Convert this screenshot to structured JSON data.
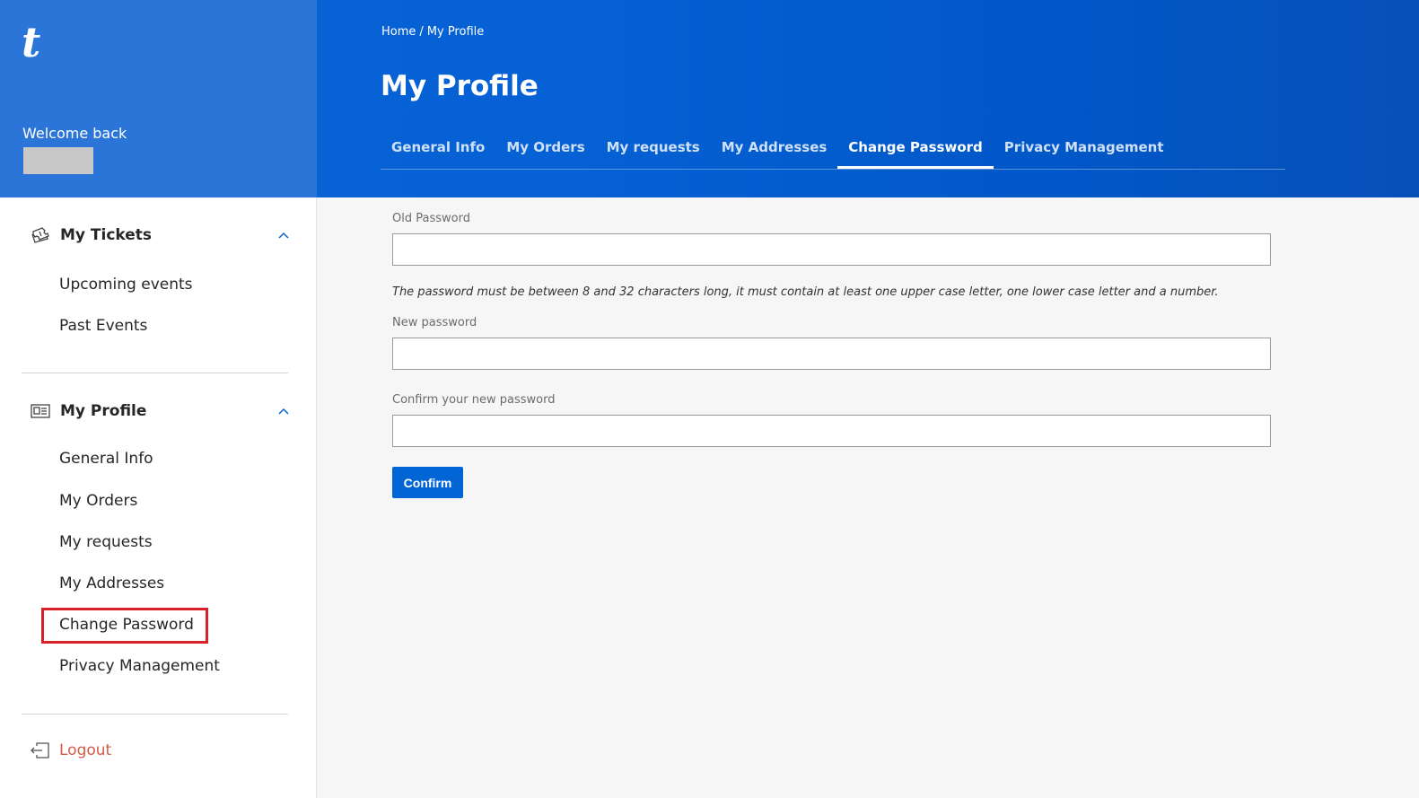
{
  "brand": {
    "logo_text": "t"
  },
  "header": {
    "welcome": "Welcome back",
    "breadcrumb": [
      "Home",
      "/",
      "My Profile"
    ],
    "title": "My Profile",
    "tabs": [
      {
        "label": "General Info",
        "active": false
      },
      {
        "label": "My Orders",
        "active": false
      },
      {
        "label": "My requests",
        "active": false
      },
      {
        "label": "My Addresses",
        "active": false
      },
      {
        "label": "Change Password",
        "active": true
      },
      {
        "label": "Privacy Management",
        "active": false
      }
    ]
  },
  "sidebar": {
    "tickets": {
      "label": "My Tickets",
      "icon": "tickets-icon",
      "items": [
        "Upcoming events",
        "Past Events"
      ]
    },
    "profile": {
      "label": "My Profile",
      "icon": "id-card-icon",
      "items": [
        "General Info",
        "My Orders",
        "My requests",
        "My Addresses",
        "Change Password",
        "Privacy Management"
      ]
    },
    "logout": {
      "label": "Logout",
      "icon": "logout-icon"
    }
  },
  "form": {
    "old_password_label": "Old Password",
    "old_password_value": "",
    "hint": "The password must be between 8 and 32 characters long, it must contain at least one upper case letter, one lower case letter and a number.",
    "new_password_label": "New password",
    "new_password_value": "",
    "confirm_password_label": "Confirm your new password",
    "confirm_password_value": "",
    "confirm_button": "Confirm"
  },
  "colors": {
    "header_blue": "#0561d4",
    "brand_panel": "#2b75d8",
    "button_blue": "#0265d6",
    "highlight_red": "#d8202a",
    "logout_red": "#d25a47"
  }
}
